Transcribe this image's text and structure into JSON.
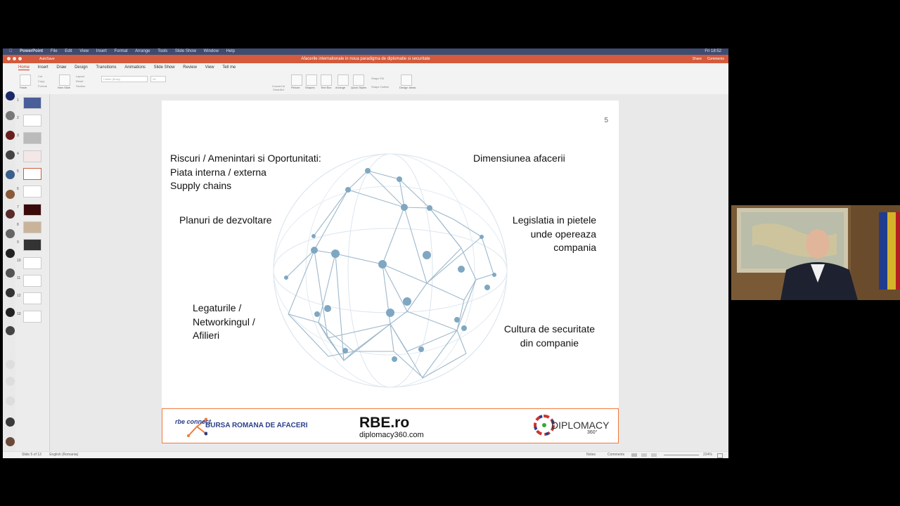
{
  "menubar": {
    "app": "PowerPoint",
    "items": [
      "File",
      "Edit",
      "View",
      "Insert",
      "Format",
      "Arrange",
      "Tools",
      "Slide Show",
      "Window",
      "Help"
    ],
    "clock": "Fri 18:52"
  },
  "titlebar": {
    "autosave": "AutoSave",
    "document_title": "Afacerile internationale in noua paradigma de diplomatie si securitate",
    "share": "Share",
    "comments": "Comments"
  },
  "ribbon": {
    "tabs": [
      "Home",
      "Insert",
      "Draw",
      "Design",
      "Transitions",
      "Animations",
      "Slide Show",
      "Review",
      "View",
      "Tell me"
    ],
    "buttons": {
      "paste": "Paste",
      "cut": "Cut",
      "copy": "Copy",
      "format": "Format",
      "new_slide": "New Slide",
      "layout": "Layout",
      "reset": "Reset",
      "section": "Section",
      "picture": "Picture",
      "shapes": "Shapes",
      "text_box": "Text Box",
      "arrange": "Arrange",
      "quick_styles": "Quick Styles",
      "shape_fill": "Shape Fill",
      "shape_outline": "Shape Outline",
      "convert_smartart": "Convert to SmartArt",
      "design_ideas": "Design Ideas"
    },
    "font_name": "Calibri (Body)",
    "font_size": "28"
  },
  "thumbnails": [
    "1",
    "2",
    "3",
    "4",
    "5",
    "6",
    "7",
    "8",
    "9",
    "10",
    "11",
    "12",
    "13"
  ],
  "selected_slide": 5,
  "slide": {
    "page_number": "5",
    "top_left": [
      "Riscuri / Amenintari si Oportunitati:",
      "Piata interna / externa",
      "Supply chains"
    ],
    "top_right": "Dimensiunea afacerii",
    "mid_left": "Planuri de dezvoltare",
    "mid_right": [
      "Legislatia in pietele",
      "unde opereaza",
      "compania"
    ],
    "bottom_left": [
      "Legaturile /",
      "Networkingul /",
      "Afilieri"
    ],
    "bottom_right": [
      "Cultura de securitate",
      "din companie"
    ],
    "footer": {
      "rbe_connect": "rbe connect",
      "bursa": "BURSA ROMANA DE AFACERI",
      "rbe_ro": "RBE.ro",
      "diplomacy_url": "diplomacy360.com",
      "diplomacy_logo": "DIPLOMACY",
      "diplomacy_360": "360°"
    }
  },
  "statusbar": {
    "slide_info": "Slide 5 of 13",
    "language": "English (Romania)",
    "notes": "Notes",
    "comments": "Comments",
    "zoom": "224%"
  },
  "colors": {
    "title_bar": "#d35a3c",
    "accent": "#c43e1c",
    "footer_border": "#f07a3c",
    "globe": "#9db8cc",
    "globe_node": "#7fa7c2"
  }
}
